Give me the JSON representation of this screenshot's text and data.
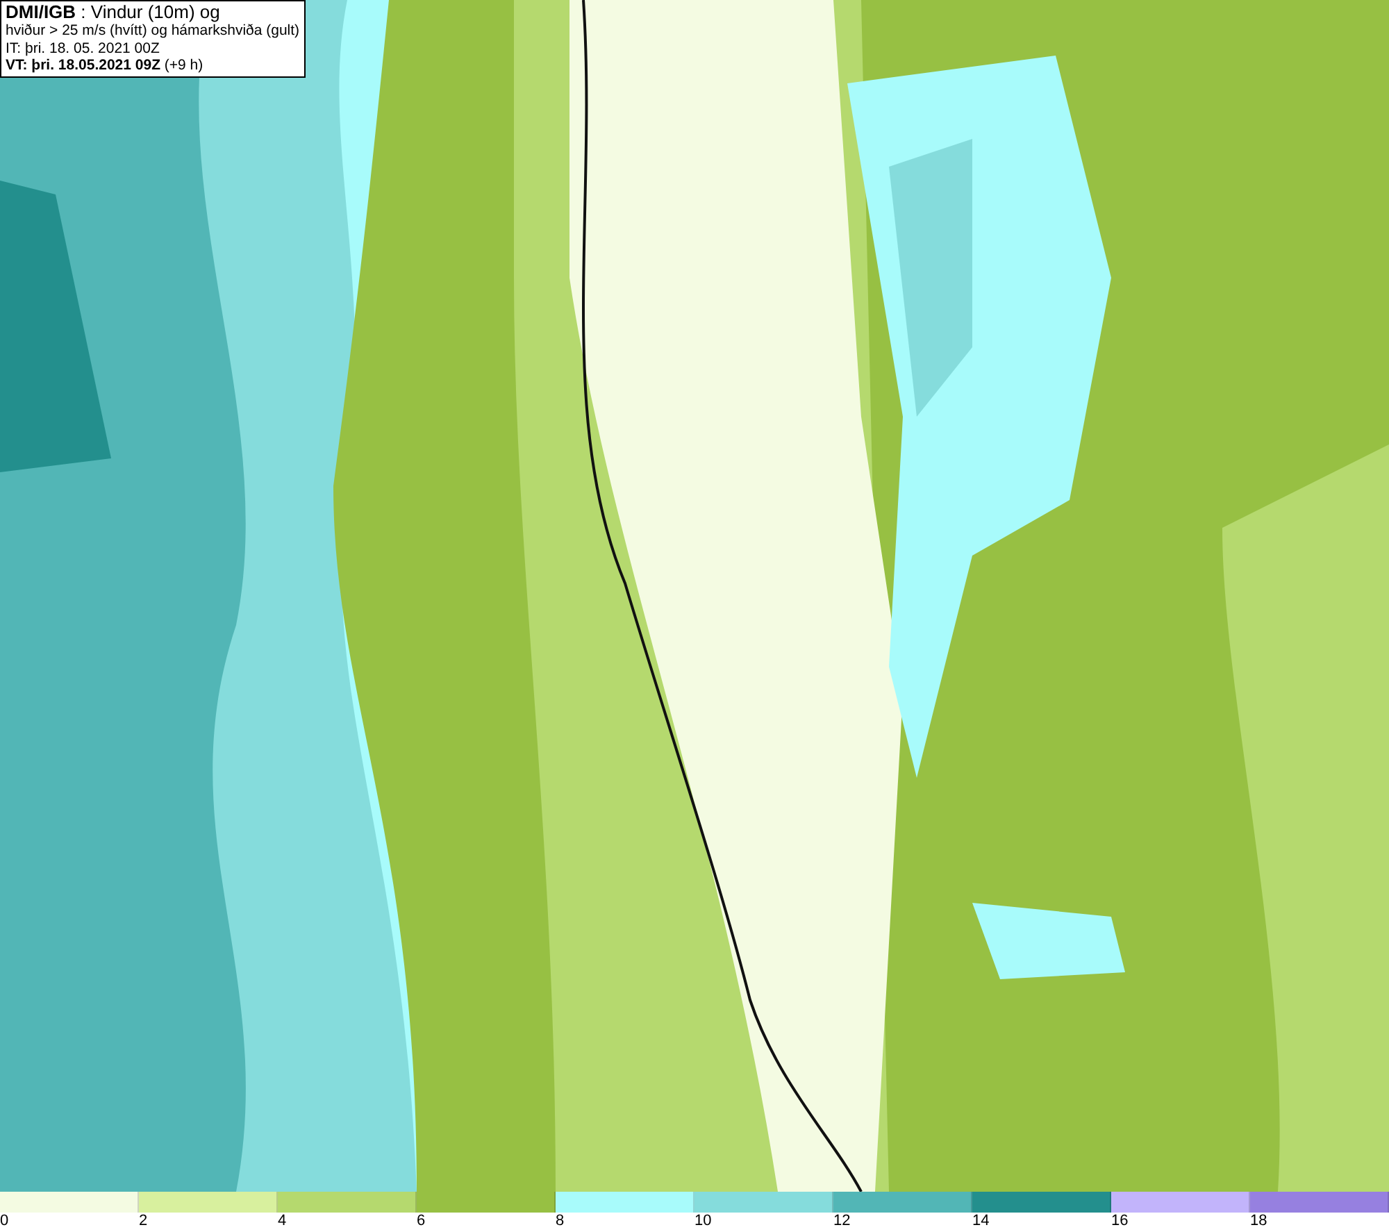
{
  "header": {
    "lines": [
      "**DMI/IGB** : Vindur (10m) og",
      "hviður > 25 m/s (hvítt) og hámarkshviða (gult)",
      "IT: þri. 18. 05. 2021 00Z",
      "**VT: þri. 18.05.2021 09Z** (+9 h)"
    ]
  },
  "legend": {
    "segments": [
      {
        "label": "0",
        "color": "#f4fbe2"
      },
      {
        "label": "2",
        "color": "#d8f09e"
      },
      {
        "label": "4",
        "color": "#b5d96e"
      },
      {
        "label": "6",
        "color": "#97c043"
      },
      {
        "label": "8",
        "color": "#a8fbfb"
      },
      {
        "label": "10",
        "color": "#85dcdc"
      },
      {
        "label": "12",
        "color": "#52b6b6"
      },
      {
        "label": "14",
        "color": "#238f8d"
      },
      {
        "label": "16",
        "color": "#c2b4fb"
      },
      {
        "label": "18",
        "color": "#9680e0"
      }
    ]
  }
}
